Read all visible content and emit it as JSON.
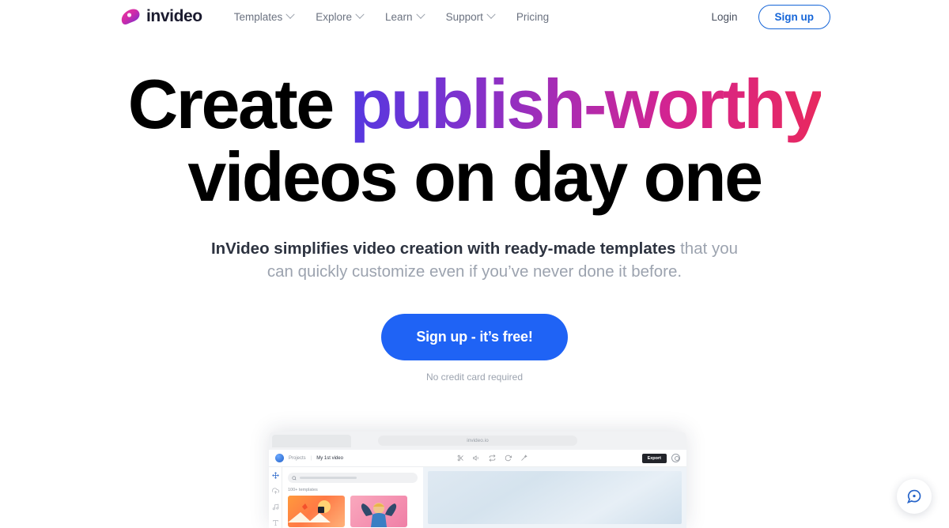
{
  "nav": {
    "brand": "invideo",
    "logo_icon": "invideo-blob-logo",
    "items": [
      {
        "label": "Templates",
        "has_caret": true
      },
      {
        "label": "Explore",
        "has_caret": true
      },
      {
        "label": "Learn",
        "has_caret": true
      },
      {
        "label": "Support",
        "has_caret": true
      },
      {
        "label": "Pricing",
        "has_caret": false
      }
    ],
    "login_label": "Login",
    "signup_label": "Sign up"
  },
  "hero": {
    "headline_part1": "Create ",
    "headline_gradient": "publish-worthy",
    "headline_line2": "videos on day one",
    "subhead_bold": "InVideo simplifies video creation with ready-made templates",
    "subhead_rest": " that you can quickly customize even if you’ve never done it before.",
    "cta_label": "Sign up - it’s free!",
    "cta_note": "No credit card required"
  },
  "mockup": {
    "browser_url": "invideo.io",
    "breadcrumb_root": "Projects",
    "breadcrumb_sep": "|",
    "breadcrumb_current": "My 1st video",
    "toolbar_icons": [
      "cut-icon",
      "volume-icon",
      "transition-icon",
      "rotate-icon",
      "magic-wand-icon"
    ],
    "export_label": "Export",
    "avatar_icon": "user-avatar-icon",
    "rail_icons": [
      "templates-move-icon",
      "cloud-upload-icon",
      "music-note-icon",
      "text-icon"
    ],
    "search_placeholder": "",
    "panel_label": "100+ templates",
    "thumbnails": [
      "template-thumb-runner",
      "template-thumb-character"
    ]
  },
  "chat": {
    "icon": "chat-bubble-icon"
  },
  "colors": {
    "accent_blue": "#1f63f5",
    "link_blue": "#1565d8",
    "grad_start": "#5538e0",
    "grad_end": "#e8295f",
    "text_dark": "#2d3340",
    "text_muted": "#9ca3af"
  }
}
